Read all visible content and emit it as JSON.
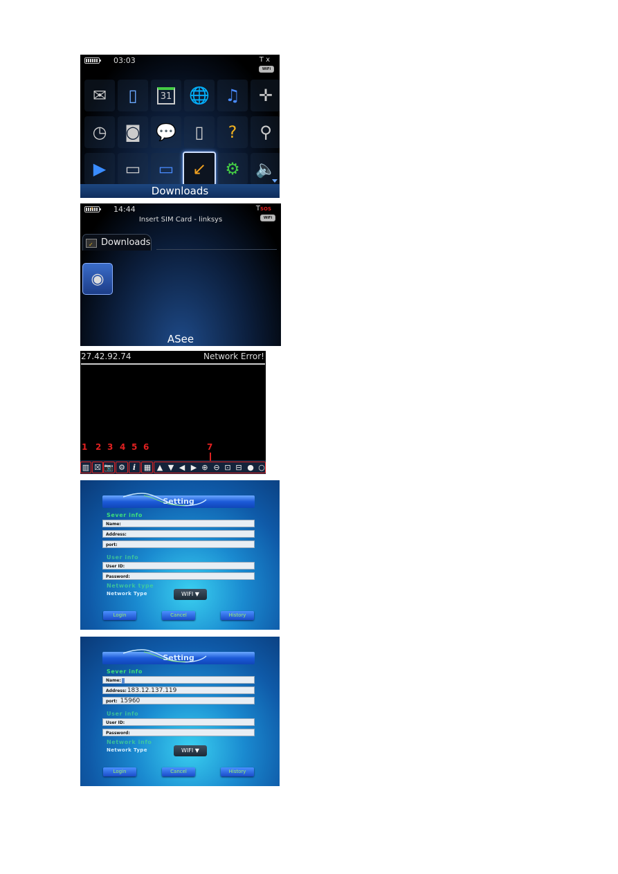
{
  "home_screen": {
    "status": {
      "time": "03:03",
      "battery": "battery-full-icon",
      "signal": "T x",
      "wifi": "WiFi"
    },
    "icons": [
      [
        "messages-icon",
        "contacts-icon",
        "calendar-icon",
        "browser-icon",
        "media-icon",
        "maps-icon"
      ],
      [
        "clock-icon",
        "camera-icon",
        "bbm-icon",
        "setup-icon",
        "help-icon",
        "search-icon"
      ],
      [
        "video-icon",
        "folder-icon",
        "folder-games-icon",
        "downloads-folder-icon",
        "folder-settings-icon",
        "sound-icon"
      ]
    ],
    "calendar_day": "31",
    "selected_label": "Downloads"
  },
  "downloads_screen": {
    "status": {
      "time": "14:44",
      "network": "Insert SIM Card - linksys",
      "signal": "SOS",
      "wifi": "WiFi"
    },
    "tab_label": "Downloads",
    "app_label": "ASee"
  },
  "viewer_screen": {
    "ip": "27.42.92.74",
    "status": "Network Error!",
    "callouts": [
      "1",
      "2",
      "3",
      "4",
      "5",
      "6",
      "7"
    ],
    "toolbar_icons": [
      {
        "name": "layout-icon",
        "glyph": "▥"
      },
      {
        "name": "close-icon",
        "glyph": "☒"
      },
      {
        "name": "snapshot-camera-icon",
        "glyph": "📷"
      },
      {
        "name": "settings-gear-icon",
        "glyph": "⚙"
      },
      {
        "name": "info-icon",
        "glyph": "i"
      },
      {
        "name": "multi-view-icon",
        "glyph": "▦"
      },
      {
        "name": "arrow-up-icon",
        "glyph": "▲"
      },
      {
        "name": "arrow-down-icon",
        "glyph": "▼"
      },
      {
        "name": "arrow-left-icon",
        "glyph": "◀"
      },
      {
        "name": "arrow-right-icon",
        "glyph": "▶"
      },
      {
        "name": "zoom-in-icon",
        "glyph": "⊕"
      },
      {
        "name": "zoom-out-icon",
        "glyph": "⊖"
      },
      {
        "name": "focus-in-icon",
        "glyph": "⊡"
      },
      {
        "name": "focus-out-icon",
        "glyph": "⊟"
      },
      {
        "name": "iris-open-icon",
        "glyph": "●"
      },
      {
        "name": "iris-close-icon",
        "glyph": "○"
      }
    ],
    "callout_color": "#e02020"
  },
  "settings_empty": {
    "title": "Setting",
    "sections": {
      "server": "Sever info",
      "user": "User info",
      "network": "Network type"
    },
    "fields": {
      "name": "Name:",
      "address": "Address:",
      "port": "port:",
      "user_id": "User ID:",
      "password": "Password:"
    },
    "values": {
      "name": "",
      "address": "",
      "port": ""
    },
    "network_type_label": "Network Type",
    "network_type_value": "WIFI ▼",
    "buttons": {
      "login": "Login",
      "cancel": "Cancel",
      "history": "History"
    }
  },
  "settings_filled": {
    "title": "Setting",
    "sections": {
      "server": "Sever info",
      "user": "User info",
      "network": "Network info"
    },
    "fields": {
      "name": "Name:",
      "address": "Address:",
      "port": "port:",
      "user_id": "User ID:",
      "password": "Password:"
    },
    "values": {
      "name": "",
      "address": "183.12.137.119",
      "port": "15960"
    },
    "network_type_label": "Network Type",
    "network_type_value": "WIFI ▼",
    "buttons": {
      "login": "Login",
      "cancel": "Cancel",
      "history": "History"
    }
  }
}
